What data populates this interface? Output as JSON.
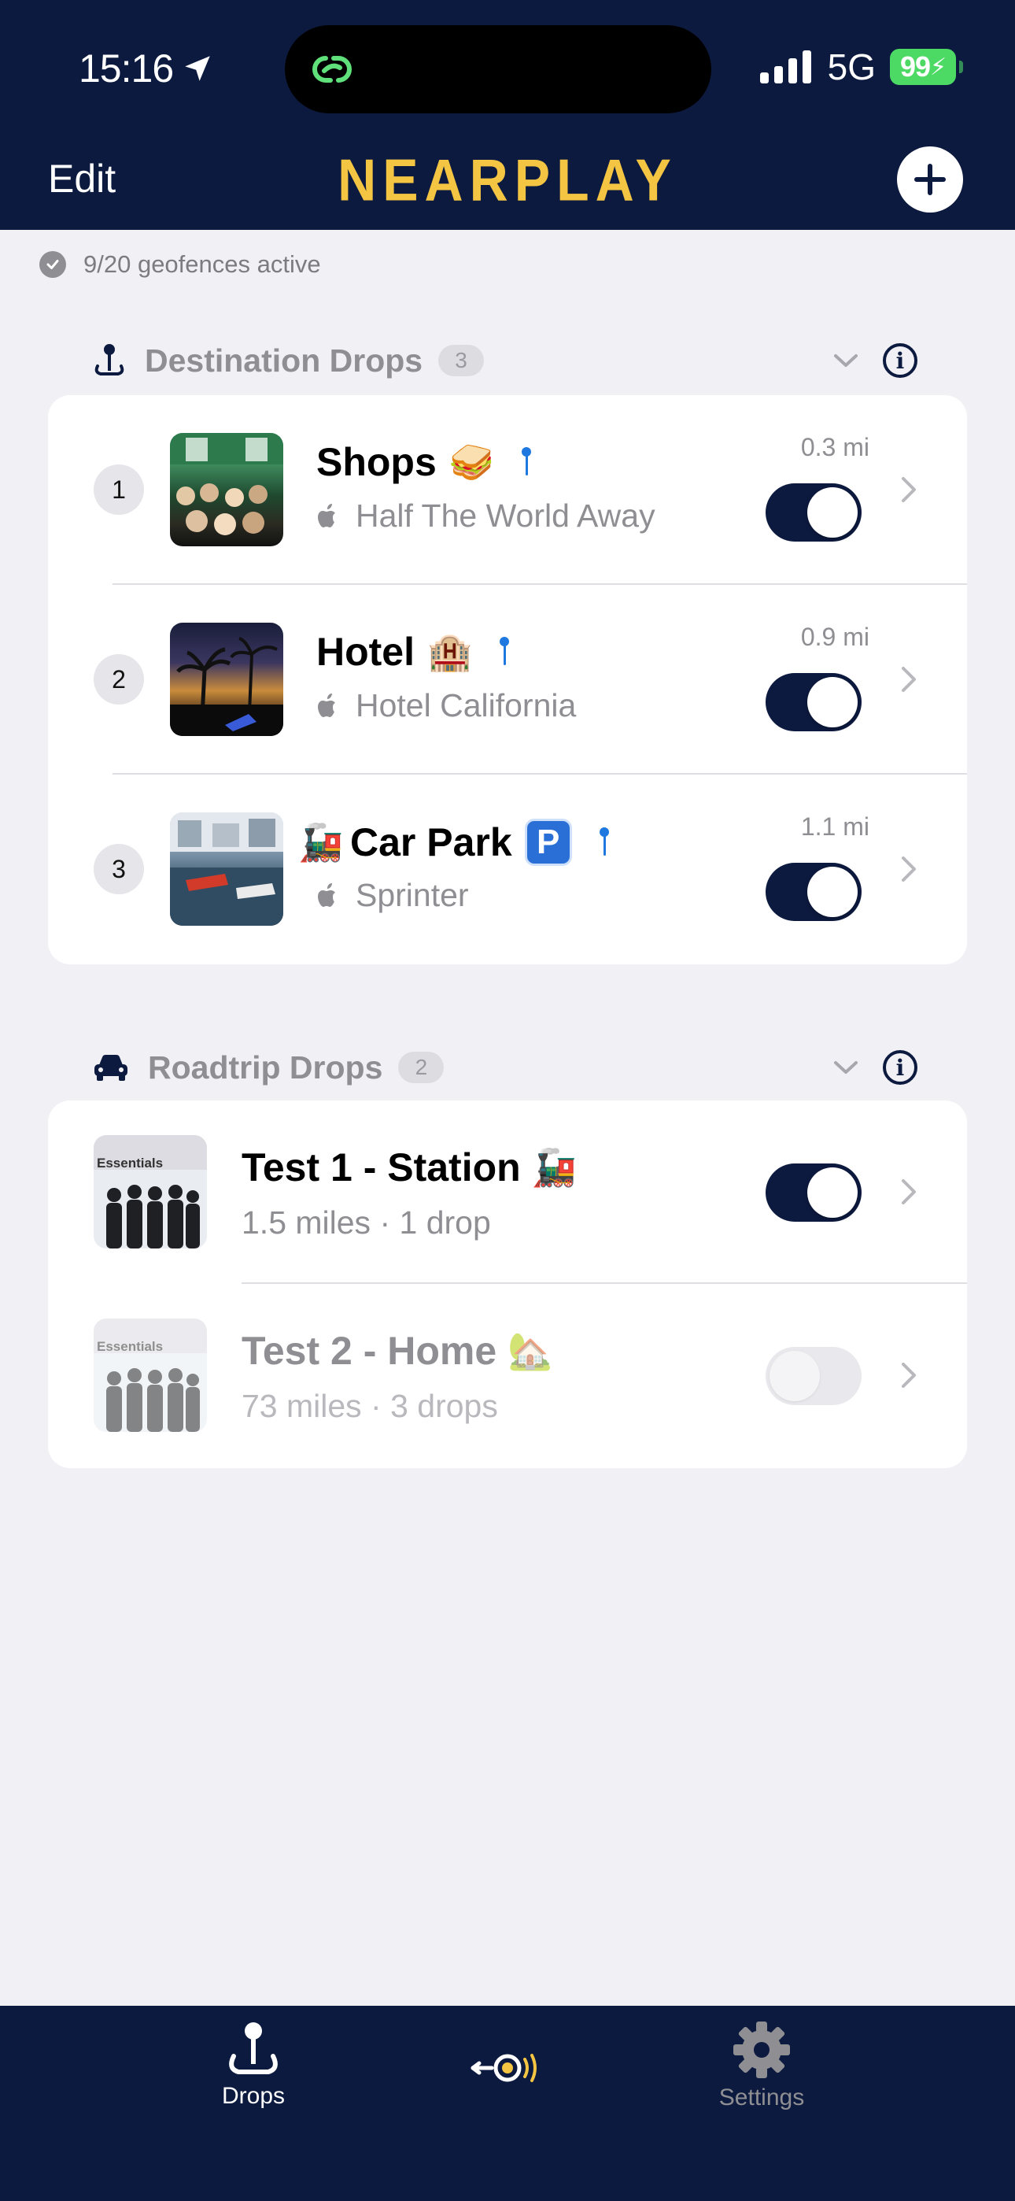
{
  "status_bar": {
    "time": "15:16",
    "network": "5G",
    "battery": "99"
  },
  "header": {
    "edit_label": "Edit",
    "logo_text": "NEARPLAY"
  },
  "geofence_status": "9/20 geofences active",
  "destination_section": {
    "title": "Destination Drops",
    "count": "3",
    "items": [
      {
        "index": "1",
        "title": "Shops",
        "emoji": "🥪",
        "subtitle": "Half The World Away",
        "distance": "0.3 mi",
        "enabled": true
      },
      {
        "index": "2",
        "title": "Hotel",
        "emoji": "🏨",
        "subtitle": "Hotel California",
        "distance": "0.9 mi",
        "enabled": true
      },
      {
        "index": "3",
        "lead_emoji": "🚂",
        "title": "Car Park",
        "badge": "P",
        "subtitle": "Sprinter",
        "distance": "1.1 mi",
        "enabled": true
      }
    ]
  },
  "roadtrip_section": {
    "title": "Roadtrip Drops",
    "count": "2",
    "items": [
      {
        "title": "Test 1 - Station",
        "emoji": "🚂",
        "subtitle": "1.5 miles · 1 drop",
        "art_label": "Essentials",
        "enabled": true
      },
      {
        "title": "Test 2 - Home",
        "emoji": "🏡",
        "subtitle": "73 miles · 3 drops",
        "art_label": "Essentials",
        "enabled": false
      }
    ]
  },
  "tab_bar": {
    "drops_label": "Drops",
    "settings_label": "Settings"
  },
  "colors": {
    "navy": "#0d1a3f",
    "gold": "#f4c542",
    "pin_blue": "#1e78e0",
    "battery_green": "#4cd964"
  }
}
